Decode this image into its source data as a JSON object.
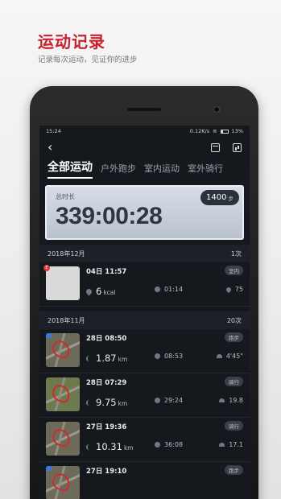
{
  "promo": {
    "title": "运动记录",
    "subtitle": "记录每次运动，见证你的进步"
  },
  "status_bar": {
    "time": "15:24",
    "network": "0.12K/s",
    "battery": "13%"
  },
  "header": {
    "back_icon": "back-arrow-icon",
    "calendar_icon": "calendar-icon",
    "stats_icon": "bar-chart-icon"
  },
  "tabs": [
    {
      "label": "全部运动",
      "active": true
    },
    {
      "label": "户外跑步",
      "active": false
    },
    {
      "label": "室内运动",
      "active": false
    },
    {
      "label": "室外骑行",
      "active": false
    }
  ],
  "summary": {
    "label": "总时长",
    "value": "339:00:28",
    "steps": "1400",
    "steps_unit": "步"
  },
  "months": [
    {
      "label": "2018年12月",
      "count": "1次",
      "records": [
        {
          "date": "04日 11:57",
          "type": "室内",
          "kcal": "6",
          "kcal_unit": "kcal",
          "duration": "01:14",
          "heart": "75"
        }
      ]
    },
    {
      "label": "2018年11月",
      "count": "20次",
      "records": [
        {
          "date": "28日 08:50",
          "type": "跑步",
          "distance": "1.87",
          "unit": "km",
          "duration": "08:53",
          "pace": "4'45\""
        },
        {
          "date": "28日 07:29",
          "type": "骑行",
          "distance": "9.75",
          "unit": "km",
          "duration": "29:24",
          "speed": "19.8"
        },
        {
          "date": "27日 19:36",
          "type": "骑行",
          "distance": "10.31",
          "unit": "km",
          "duration": "36:08",
          "speed": "17.1"
        },
        {
          "date": "27日 19:10",
          "type": "跑步"
        }
      ]
    }
  ]
}
